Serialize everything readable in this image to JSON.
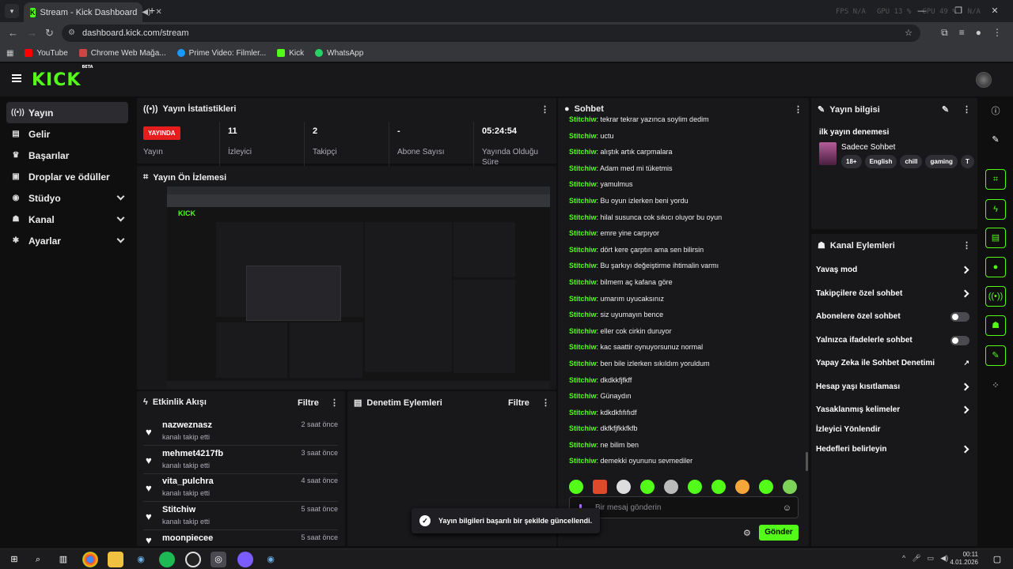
{
  "browser": {
    "tab_title": "Stream - Kick Dashboard",
    "url": "dashboard.kick.com/stream",
    "bookmarks": [
      "YouTube",
      "Chrome Web Mağa...",
      "Prime Video: Filmler...",
      "Kick",
      "WhatsApp"
    ],
    "overlay": {
      "fps": "FPS N/A",
      "gpu": "GPU 13 %",
      "cpu": "CPU 49 %",
      "na": "N/A"
    }
  },
  "brand": {
    "name": "KICK",
    "badge": "BETA"
  },
  "sidebar": {
    "items": [
      {
        "label": "Yayın",
        "icon": "broadcast-icon"
      },
      {
        "label": "Gelir",
        "icon": "revenue-icon"
      },
      {
        "label": "Başarılar",
        "icon": "trophy-icon"
      },
      {
        "label": "Droplar ve ödüller",
        "icon": "gift-icon"
      },
      {
        "label": "Stüdyo",
        "icon": "studio-icon"
      },
      {
        "label": "Kanal",
        "icon": "channel-icon"
      },
      {
        "label": "Ayarlar",
        "icon": "gear-icon"
      }
    ]
  },
  "stats": {
    "title": "Yayın İstatistikleri",
    "live_badge": "YAYINDA",
    "items": [
      {
        "value": "",
        "label": "Yayın"
      },
      {
        "value": "11",
        "label": "İzleyici"
      },
      {
        "value": "2",
        "label": "Takipçi"
      },
      {
        "value": "-",
        "label": "Abone Sayısı"
      },
      {
        "value": "05:24:54",
        "label": "Yayında Olduğu Süre"
      }
    ]
  },
  "preview": {
    "title": "Yayın Ön İzlemesi"
  },
  "activity": {
    "title": "Etkinlik Akışı",
    "filter": "Filtre",
    "rows": [
      {
        "name": "nazweznasz",
        "sub": "kanalı takip etti",
        "time": "2 saat önce"
      },
      {
        "name": "mehmet4217fb",
        "sub": "kanalı takip etti",
        "time": "3 saat önce"
      },
      {
        "name": "vita_pulchra",
        "sub": "kanalı takip etti",
        "time": "4 saat önce"
      },
      {
        "name": "Stitchiw",
        "sub": "kanalı takip etti",
        "time": "5 saat önce"
      },
      {
        "name": "moonpiecee",
        "sub": "",
        "time": "5 saat önce"
      }
    ]
  },
  "moderation": {
    "title": "Denetim Eylemleri",
    "filter": "Filtre"
  },
  "chat": {
    "title": "Sohbet",
    "user": "Stitchiw",
    "messages": [
      "tekrar tekrar yazınca soylim dedim",
      "uctu",
      "alıştık artık carpmalara",
      "Adam med mi tüketmis",
      "yamulmus",
      "Bu oyun izlerken beni yordu",
      "hilal susunca cok sıkıcı oluyor bu oyun",
      "emre yine carpıyor",
      "dört kere çarptın ama sen bilirsin",
      "Bu şarkıyı değeiştirme ihtimalin varmı",
      "bilmem aç kafana göre",
      "umarım uyucaksınız",
      "siz uyumayın bence",
      "eller cok cirkin duruyor",
      "kac saattir oynuyorsunuz normal",
      "ben bile izlerken sıkıldım yoruldum",
      "dkdkkfjfkff",
      "Günaydın",
      "kdkdkfıfıfıdf",
      "dkfkfjfkkfkfb",
      "ne bilim ben",
      "demekki oyununu sevmediler"
    ],
    "placeholder": "Bir mesaj gönderin",
    "send": "Gönder"
  },
  "stream_info": {
    "title": "Yayın bilgisi",
    "stream_title": "ilk yayın denemesi",
    "category": "Sadece Sohbet",
    "tags": [
      "18+",
      "English",
      "chill",
      "gaming",
      "T"
    ]
  },
  "channel_actions": {
    "title": "Kanal Eylemleri",
    "rows": [
      {
        "label": "Yavaş mod",
        "control": "chevron"
      },
      {
        "label": "Takipçilere özel sohbet",
        "control": "chevron"
      },
      {
        "label": "Abonelere özel sohbet",
        "control": "toggle"
      },
      {
        "label": "Yalnızca ifadelerle sohbet",
        "control": "toggle"
      },
      {
        "label": "Yapay Zeka ile Sohbet Denetimi",
        "control": "external"
      },
      {
        "label": "Hesap yaşı kısıtlaması",
        "control": "chevron"
      },
      {
        "label": "Yasaklanmış kelimeler",
        "control": "chevron"
      },
      {
        "label": "İzleyici Yönlendir",
        "control": "none"
      },
      {
        "label": "Hedefleri belirleyin",
        "control": "chevron"
      }
    ]
  },
  "toast": {
    "message": "Yayın bilgileri başarılı bir şekilde güncellendi."
  },
  "taskbar": {
    "time": "00:11",
    "date": "4.01.2026"
  },
  "colors": {
    "accent": "#53fc18",
    "live": "#e51d1d",
    "panel": "#18181b",
    "bg": "#0f0f10"
  }
}
